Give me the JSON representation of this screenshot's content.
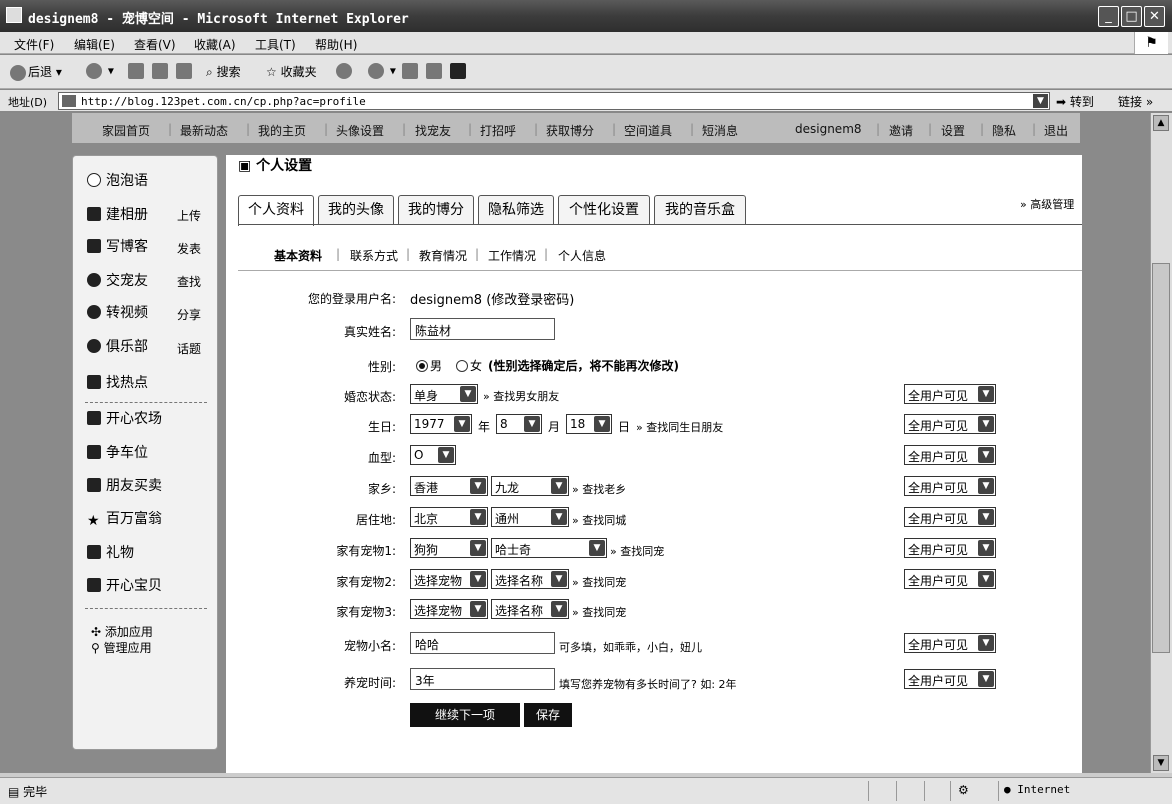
{
  "window": {
    "title": "designem8 - 宠博空间 - Microsoft Internet Explorer",
    "minimize": "_",
    "maximize": "□",
    "close": "✕"
  },
  "menu": [
    "文件(F)",
    "编辑(E)",
    "查看(V)",
    "收藏(A)",
    "工具(T)",
    "帮助(H)"
  ],
  "toolbar": {
    "back": "后退",
    "search": "搜索",
    "favorites": "收藏夹"
  },
  "address": {
    "label": "地址(D)",
    "url": "http://blog.123pet.com.cn/cp.php?ac=profile",
    "go": "转到",
    "links": "链接"
  },
  "topnav": [
    "家园首页",
    "最新动态",
    "我的主页",
    "头像设置",
    "找宠友",
    "打招呼",
    "获取博分",
    "空间道具",
    "短消息",
    "designem8",
    "邀请",
    "设置",
    "隐私",
    "退出"
  ],
  "sidebar": {
    "items": [
      {
        "label": "泡泡语",
        "icon": "bubble-icon"
      },
      {
        "label": "建相册",
        "icon": "album-icon",
        "sub": "上传"
      },
      {
        "label": "写博客",
        "icon": "blog-icon",
        "sub": "发表"
      },
      {
        "label": "交宠友",
        "icon": "friend-icon",
        "sub": "查找"
      },
      {
        "label": "转视频",
        "icon": "video-icon",
        "sub": "分享"
      },
      {
        "label": "俱乐部",
        "icon": "club-icon",
        "sub": "话题"
      },
      {
        "label": "找热点",
        "icon": "hot-icon"
      },
      {
        "label": "开心农场",
        "icon": "farm-icon"
      },
      {
        "label": "争车位",
        "icon": "parking-icon"
      },
      {
        "label": "朋友买卖",
        "icon": "trade-icon"
      },
      {
        "label": "百万富翁",
        "icon": "star-icon"
      },
      {
        "label": "礼物",
        "icon": "gift-icon"
      },
      {
        "label": "开心宝贝",
        "icon": "baby-icon"
      }
    ],
    "add_app": "添加应用",
    "manage_app": "管理应用"
  },
  "page": {
    "title": "个人设置",
    "advanced": "» 高级管理",
    "tabs": [
      "个人资料",
      "我的头像",
      "我的博分",
      "隐私筛选",
      "个性化设置",
      "我的音乐盒"
    ],
    "subtabs": [
      "基本资料",
      "联系方式",
      "教育情况",
      "工作情况",
      "个人信息"
    ]
  },
  "form": {
    "login_label": "您的登录用户名:",
    "login_value": "designem8 (修改登录密码)",
    "name_label": "真实姓名:",
    "name_value": "陈益材",
    "gender_label": "性别:",
    "gender_male": "男",
    "gender_female": "女",
    "gender_note": "(性别选择确定后，将不能再次修改)",
    "marital_label": "婚恋状态:",
    "marital_value": "单身",
    "marital_link": "» 查找男女朋友",
    "birthday_label": "生日:",
    "birth_year": "1977",
    "year_unit": "年",
    "birth_month": "8",
    "month_unit": "月",
    "birth_day": "18",
    "day_unit": "日",
    "birthday_link": "» 查找同生日朋友",
    "blood_label": "血型:",
    "blood_value": "O",
    "hometown_label": "家乡:",
    "hometown_prov": "香港",
    "hometown_city": "九龙",
    "hometown_link": "» 查找老乡",
    "residence_label": "居住地:",
    "residence_prov": "北京",
    "residence_city": "通州",
    "residence_link": "» 查找同城",
    "pet1_label": "家有宠物1:",
    "pet1_type": "狗狗",
    "pet1_breed": "哈士奇",
    "pet1_link": "» 查找同宠",
    "pet2_label": "家有宠物2:",
    "pet2_type": "选择宠物",
    "pet2_breed": "选择名称",
    "pet2_link": "» 查找同宠",
    "pet3_label": "家有宠物3:",
    "pet3_type": "选择宠物",
    "pet3_breed": "选择名称",
    "pet3_link": "» 查找同宠",
    "nick_label": "宠物小名:",
    "nick_value": "哈哈",
    "nick_hint": "可多填，如乖乖，小白，妞儿",
    "time_label": "养宠时间:",
    "time_value": "3年",
    "time_hint": "填写您养宠物有多长时间了? 如: 2年",
    "privacy": "全用户可见",
    "btn_next": "继续下一项",
    "btn_save": "保存"
  },
  "status": {
    "text": "完毕",
    "zone": "Internet"
  }
}
